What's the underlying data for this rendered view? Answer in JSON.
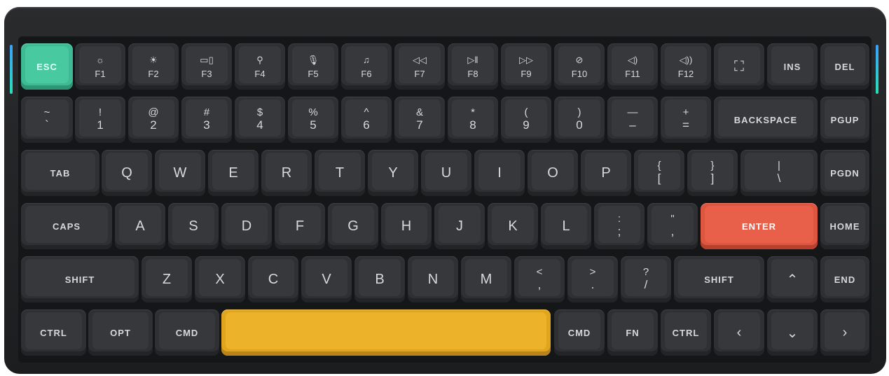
{
  "keyboard": {
    "row0": {
      "esc": "ESC",
      "f1": "F1",
      "f2": "F2",
      "f3": "F3",
      "f4": "F4",
      "f5": "F5",
      "f6": "F6",
      "f7": "F7",
      "f8": "F8",
      "f9": "F9",
      "f10": "F10",
      "f11": "F11",
      "f12": "F12",
      "ins": "INS",
      "del": "DEL"
    },
    "row1": {
      "tilde_top": "~",
      "tilde_bot": "`",
      "k1_top": "!",
      "k1_bot": "1",
      "k2_top": "@",
      "k2_bot": "2",
      "k3_top": "#",
      "k3_bot": "3",
      "k4_top": "$",
      "k4_bot": "4",
      "k5_top": "%",
      "k5_bot": "5",
      "k6_top": "^",
      "k6_bot": "6",
      "k7_top": "&",
      "k7_bot": "7",
      "k8_top": "*",
      "k8_bot": "8",
      "k9_top": "(",
      "k9_bot": "9",
      "k0_top": ")",
      "k0_bot": "0",
      "minus_top": "—",
      "minus_bot": "–",
      "equal_top": "+",
      "equal_bot": "=",
      "backspace": "BACKSPACE",
      "pgup": "PGUP"
    },
    "row2": {
      "tab": "TAB",
      "q": "Q",
      "w": "W",
      "e": "E",
      "r": "R",
      "t": "T",
      "y": "Y",
      "u": "U",
      "i": "I",
      "o": "O",
      "p": "P",
      "lbrace_top": "{",
      "lbrace_bot": "[",
      "rbrace_top": "}",
      "rbrace_bot": "]",
      "pipe_top": "|",
      "pipe_bot": "\\",
      "pgdn": "PGDN"
    },
    "row3": {
      "caps": "CAPS",
      "a": "A",
      "s": "S",
      "d": "D",
      "f": "F",
      "g": "G",
      "h": "H",
      "j": "J",
      "k": "K",
      "l": "L",
      "colon_top": ":",
      "colon_bot": ";",
      "quote_top": "\"",
      "quote_bot": ",",
      "enter": "ENTER",
      "home": "HOME"
    },
    "row4": {
      "shift_l": "SHIFT",
      "z": "Z",
      "x": "X",
      "c": "C",
      "v": "V",
      "b": "B",
      "n": "N",
      "m": "M",
      "lt_top": "<",
      "lt_bot": ",",
      "gt_top": ">",
      "gt_bot": ".",
      "q_top": "?",
      "q_bot": "/",
      "shift_r": "SHIFT",
      "up": "⌃",
      "end": "END"
    },
    "row5": {
      "ctrl_l": "CTRL",
      "opt": "OPT",
      "cmd_l": "CMD",
      "cmd_r": "CMD",
      "fn": "FN",
      "ctrl_r": "CTRL",
      "left": "‹",
      "down": "⌄",
      "right": "›"
    },
    "icons": {
      "f1": "brightness-down-icon",
      "f2": "brightness-up-icon",
      "f3": "mission-control-icon",
      "f4": "search-icon",
      "f5": "microphone-icon",
      "f6": "notification-bell-icon",
      "f7": "rewind-icon",
      "f8": "play-pause-icon",
      "f9": "fast-forward-icon",
      "f10": "mute-icon",
      "f11": "volume-down-icon",
      "f12": "volume-up-icon",
      "snip": "screenshot-icon"
    },
    "colors": {
      "esc": "#49c9a0",
      "enter": "#e8604a",
      "space": "#ebb22a",
      "key": "#37383b"
    }
  }
}
